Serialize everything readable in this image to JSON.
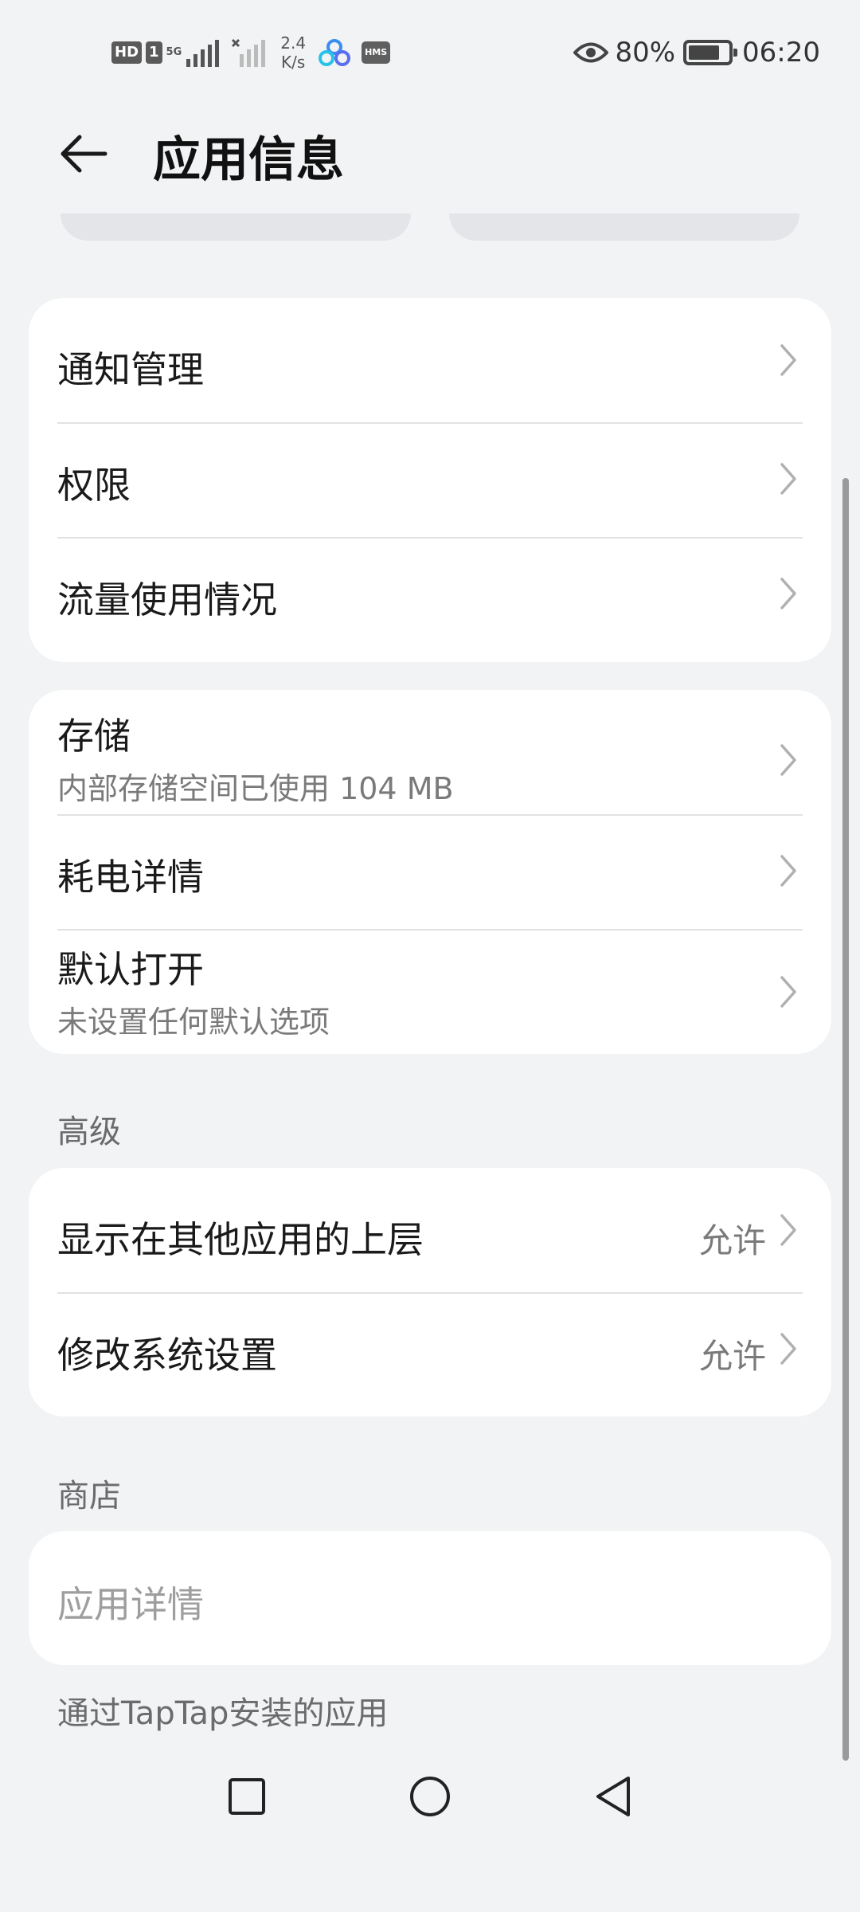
{
  "status_bar": {
    "hd_badge": "HD",
    "sim_badge": "1",
    "net_type": "5G",
    "speed_value": "2.4",
    "speed_unit": "K/s",
    "hms_label": "HMS",
    "battery_percent": "80%",
    "battery_level": 0.8,
    "time": "06:20",
    "icons": [
      "hd-icon",
      "sim-icon",
      "signal-icon",
      "signal-x-icon",
      "cloud-app-icon",
      "hms-icon",
      "eye-icon",
      "battery-icon"
    ]
  },
  "header": {
    "title": "应用信息",
    "back_icon": "back-arrow-icon"
  },
  "group1": {
    "items": [
      {
        "label": "通知管理"
      },
      {
        "label": "权限"
      },
      {
        "label": "流量使用情况"
      }
    ]
  },
  "group2": {
    "items": [
      {
        "label": "存储",
        "sub": "内部存储空间已使用 104 MB"
      },
      {
        "label": "耗电详情"
      },
      {
        "label": "默认打开",
        "sub": "未设置任何默认选项"
      }
    ]
  },
  "advanced": {
    "title": "高级",
    "items": [
      {
        "label": "显示在其他应用的上层",
        "value": "允许"
      },
      {
        "label": "修改系统设置",
        "value": "允许"
      }
    ]
  },
  "store": {
    "title": "商店",
    "item_label": "应用详情",
    "footer": "通过TapTap安装的应用"
  },
  "colors": {
    "background": "#f1f3f5",
    "card": "#ffffff",
    "primary_text": "#1a1a1a",
    "secondary_text": "#7a7a7a",
    "disabled_text": "#9e9e9e"
  },
  "nav": {
    "icons": [
      "recent-apps-icon",
      "home-icon",
      "back-nav-icon"
    ]
  }
}
